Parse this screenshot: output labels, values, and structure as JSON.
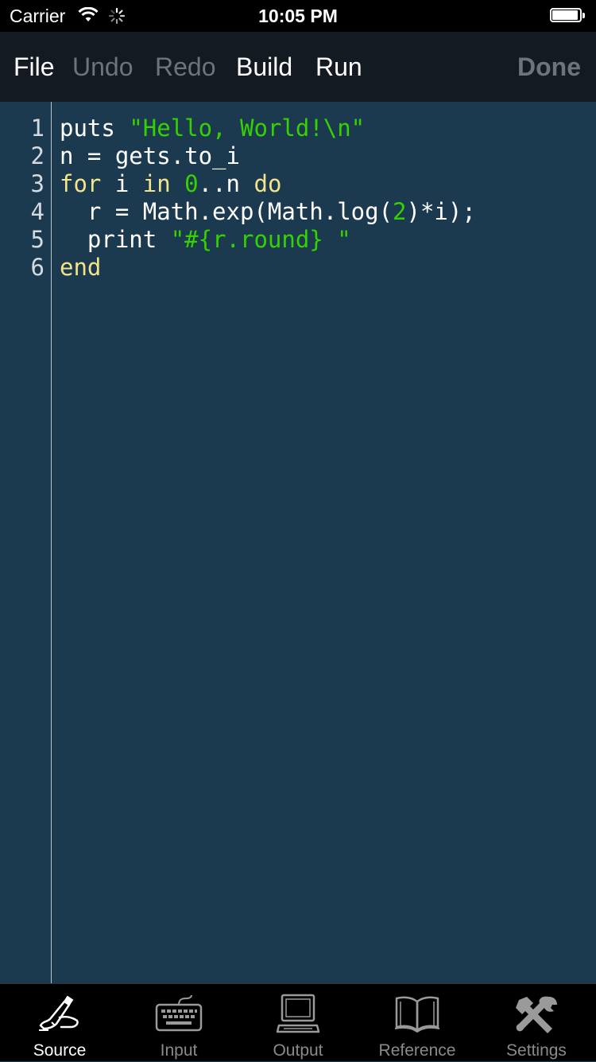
{
  "status_bar": {
    "carrier": "Carrier",
    "time": "10:05 PM",
    "battery_level": 0.95
  },
  "toolbar": {
    "file": "File",
    "undo": "Undo",
    "redo": "Redo",
    "build": "Build",
    "run": "Run",
    "done": "Done"
  },
  "editor": {
    "lines": [
      {
        "num": "1",
        "tokens": [
          {
            "t": "puts ",
            "c": "plain"
          },
          {
            "t": "\"Hello, World!\\n\"",
            "c": "string"
          }
        ]
      },
      {
        "num": "2",
        "tokens": [
          {
            "t": "n = gets.to_i",
            "c": "plain"
          }
        ]
      },
      {
        "num": "3",
        "tokens": [
          {
            "t": "for",
            "c": "keyword"
          },
          {
            "t": " i ",
            "c": "plain"
          },
          {
            "t": "in",
            "c": "keyword"
          },
          {
            "t": " ",
            "c": "plain"
          },
          {
            "t": "0",
            "c": "number"
          },
          {
            "t": "..n ",
            "c": "plain"
          },
          {
            "t": "do",
            "c": "keyword"
          }
        ]
      },
      {
        "num": "4",
        "tokens": [
          {
            "t": "  r = Math.exp(Math.log(",
            "c": "plain"
          },
          {
            "t": "2",
            "c": "number"
          },
          {
            "t": ")*i);",
            "c": "plain"
          }
        ]
      },
      {
        "num": "5",
        "tokens": [
          {
            "t": "  print ",
            "c": "plain"
          },
          {
            "t": "\"#{r.round} \"",
            "c": "string"
          }
        ]
      },
      {
        "num": "6",
        "tokens": [
          {
            "t": "end",
            "c": "keyword"
          }
        ]
      }
    ]
  },
  "tabs": [
    {
      "label": "Source",
      "icon": "pen-hand-icon",
      "active": true
    },
    {
      "label": "Input",
      "icon": "keyboard-icon",
      "active": false
    },
    {
      "label": "Output",
      "icon": "computer-icon",
      "active": false
    },
    {
      "label": "Reference",
      "icon": "book-icon",
      "active": false
    },
    {
      "label": "Settings",
      "icon": "tools-icon",
      "active": false
    }
  ],
  "colors": {
    "editor_bg": "#1b3a50",
    "string": "#35d100",
    "keyword": "#f2e488",
    "number": "#35d100",
    "plain": "#ffffff"
  }
}
